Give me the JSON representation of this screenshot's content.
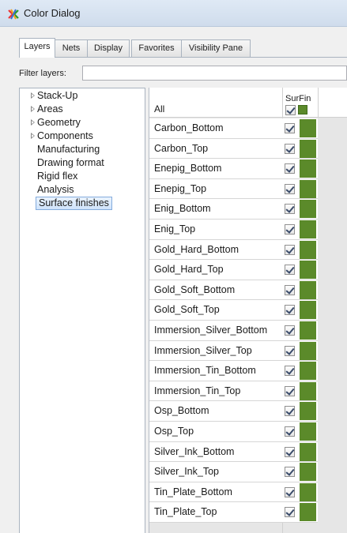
{
  "window": {
    "title": "Color Dialog",
    "icon": "color-dialog-app-icon"
  },
  "tabs": [
    {
      "label": "Layers",
      "active": true
    },
    {
      "label": "Nets",
      "active": false
    },
    {
      "label": "Display",
      "active": false
    },
    {
      "label": "Favorites",
      "active": false
    },
    {
      "label": "Visibility Pane",
      "active": false
    }
  ],
  "filter": {
    "label": "Filter layers:",
    "value": ""
  },
  "tree": {
    "items": [
      {
        "label": "Stack-Up",
        "expandable": true
      },
      {
        "label": "Areas",
        "expandable": true
      },
      {
        "label": "Geometry",
        "expandable": true
      },
      {
        "label": "Components",
        "expandable": true
      },
      {
        "label": "Manufacturing",
        "expandable": false
      },
      {
        "label": "Drawing format",
        "expandable": false
      },
      {
        "label": "Rigid flex",
        "expandable": false
      },
      {
        "label": "Analysis",
        "expandable": false
      },
      {
        "label": "Surface finishes",
        "expandable": false,
        "selected": true
      }
    ]
  },
  "grid": {
    "column_header": "SurFin",
    "all_label": "All",
    "swatch_color": "#5b8a2a",
    "rows": [
      "Carbon_Bottom",
      "Carbon_Top",
      "Enepig_Bottom",
      "Enepig_Top",
      "Enig_Bottom",
      "Enig_Top",
      "Gold_Hard_Bottom",
      "Gold_Hard_Top",
      "Gold_Soft_Bottom",
      "Gold_Soft_Top",
      "Immersion_Silver_Bottom",
      "Immersion_Silver_Top",
      "Immersion_Tin_Bottom",
      "Immersion_Tin_Top",
      "Osp_Bottom",
      "Osp_Top",
      "Silver_Ink_Bottom",
      "Silver_Ink_Top",
      "Tin_Plate_Bottom",
      "Tin_Plate_Top"
    ]
  }
}
